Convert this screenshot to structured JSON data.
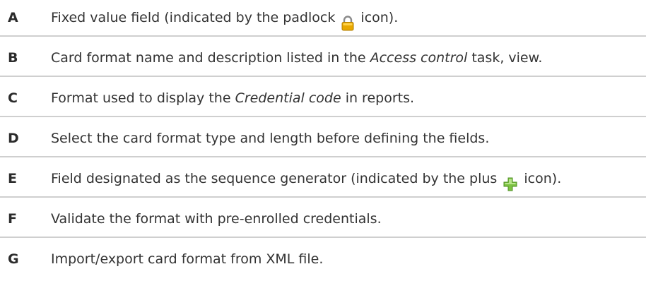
{
  "rows": [
    {
      "key": "A",
      "pre": "Fixed value field (indicated by the padlock ",
      "italic": "",
      "post": " icon).",
      "icon": "padlock-icon"
    },
    {
      "key": "B",
      "pre": "Card format name and description listed in the ",
      "italic": "Access control",
      "post": " task, view.",
      "icon": ""
    },
    {
      "key": "C",
      "pre": "Format used to display the ",
      "italic": "Credential code",
      "post": " in reports.",
      "icon": ""
    },
    {
      "key": "D",
      "pre": "Select the card format type and length before defining the fields.",
      "italic": "",
      "post": "",
      "icon": ""
    },
    {
      "key": "E",
      "pre": "Field designated as the sequence generator (indicated by the plus ",
      "italic": "",
      "post": " icon).",
      "icon": "plus-icon"
    },
    {
      "key": "F",
      "pre": "Validate the format with pre-enrolled credentials.",
      "italic": "",
      "post": "",
      "icon": ""
    },
    {
      "key": "G",
      "pre": "Import/export card format from XML file.",
      "italic": "",
      "post": "",
      "icon": ""
    }
  ],
  "colors": {
    "divider": "#cfcfcf",
    "padlock_body": "#e8a800",
    "padlock_shackle": "#8a8a8a",
    "plus_fill": "#7cc242"
  }
}
